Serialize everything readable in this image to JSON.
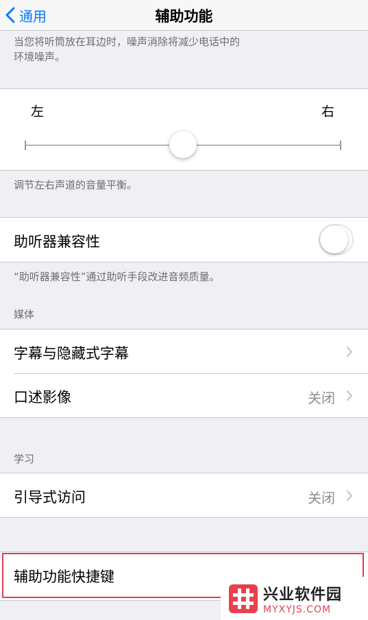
{
  "navbar": {
    "back_label": "通用",
    "title": "辅助功能"
  },
  "top_footer": {
    "line1": "当您将听筒放在耳边时，噪声消除将减少电话中的",
    "line2": "环境噪声。"
  },
  "balance": {
    "left_label": "左",
    "right_label": "右",
    "value": 0.5
  },
  "balance_footer": "调节左右声道的音量平衡。",
  "hearing_aid": {
    "label": "助听器兼容性",
    "enabled": false
  },
  "hearing_aid_footer": "“助听器兼容性”通过助听手段改进音频质量。",
  "media": {
    "header": "媒体",
    "items": [
      {
        "label": "字幕与隐藏式字幕",
        "value": ""
      },
      {
        "label": "口述影像",
        "value": "关闭"
      }
    ]
  },
  "learning": {
    "header": "学习",
    "items": [
      {
        "label": "引导式访问",
        "value": "关闭"
      }
    ]
  },
  "shortcut": {
    "label": "辅助功能快捷键"
  },
  "watermark": {
    "title": "兴业软件园",
    "subtitle": "MYXYJS.COM",
    "accent": "#e8414e"
  },
  "colors": {
    "accent": "#007aff",
    "background": "#efeff4",
    "highlight": "#e03c4b"
  }
}
